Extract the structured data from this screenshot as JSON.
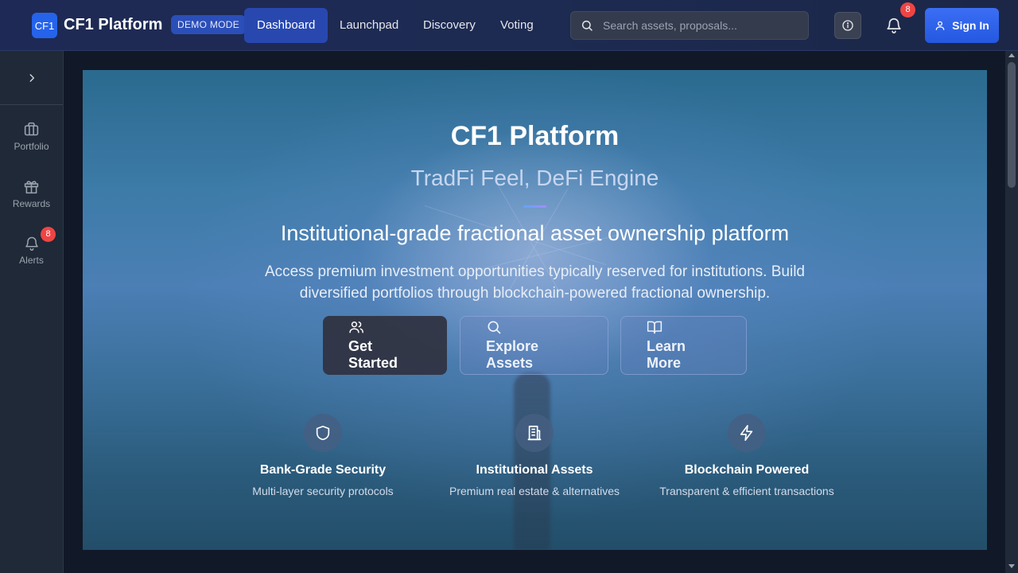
{
  "header": {
    "logo_text": "CF1",
    "brand": "CF1 Platform",
    "demo_badge": "DEMO MODE",
    "nav": [
      {
        "label": "Dashboard",
        "active": true
      },
      {
        "label": "Launchpad",
        "active": false
      },
      {
        "label": "Discovery",
        "active": false
      },
      {
        "label": "Voting",
        "active": false
      }
    ],
    "search": {
      "placeholder": "Search assets, proposals...",
      "value": ""
    },
    "notification_count": "8",
    "sign_in_label": "Sign In"
  },
  "sidebar": {
    "items": [
      {
        "label": "Portfolio",
        "icon": "briefcase-icon"
      },
      {
        "label": "Rewards",
        "icon": "gift-icon"
      },
      {
        "label": "Alerts",
        "icon": "bell-icon",
        "badge": "8"
      }
    ]
  },
  "hero": {
    "title": "CF1 Platform",
    "subtitle": "TradFi Feel, DeFi Engine",
    "tagline": "Institutional-grade fractional asset ownership platform",
    "description": "Access premium investment opportunities typically reserved for institutions. Build diversified portfolios through blockchain-powered fractional ownership.",
    "buttons": [
      {
        "label": "Get Started",
        "icon": "users-icon"
      },
      {
        "label": "Explore Assets",
        "icon": "search-icon"
      },
      {
        "label": "Learn More",
        "icon": "book-open-icon"
      }
    ],
    "features": [
      {
        "title": "Bank-Grade Security",
        "desc": "Multi-layer security protocols",
        "icon": "shield-icon"
      },
      {
        "title": "Institutional Assets",
        "desc": "Premium real estate & alternatives",
        "icon": "building-icon"
      },
      {
        "title": "Blockchain Powered",
        "desc": "Transparent & efficient transactions",
        "icon": "lightning-icon"
      }
    ]
  },
  "colors": {
    "accent": "#2563eb",
    "nav_active": "#2848b0",
    "badge": "#ef4444",
    "sidebar_bg": "#1f2937",
    "page_bg": "#111827"
  }
}
